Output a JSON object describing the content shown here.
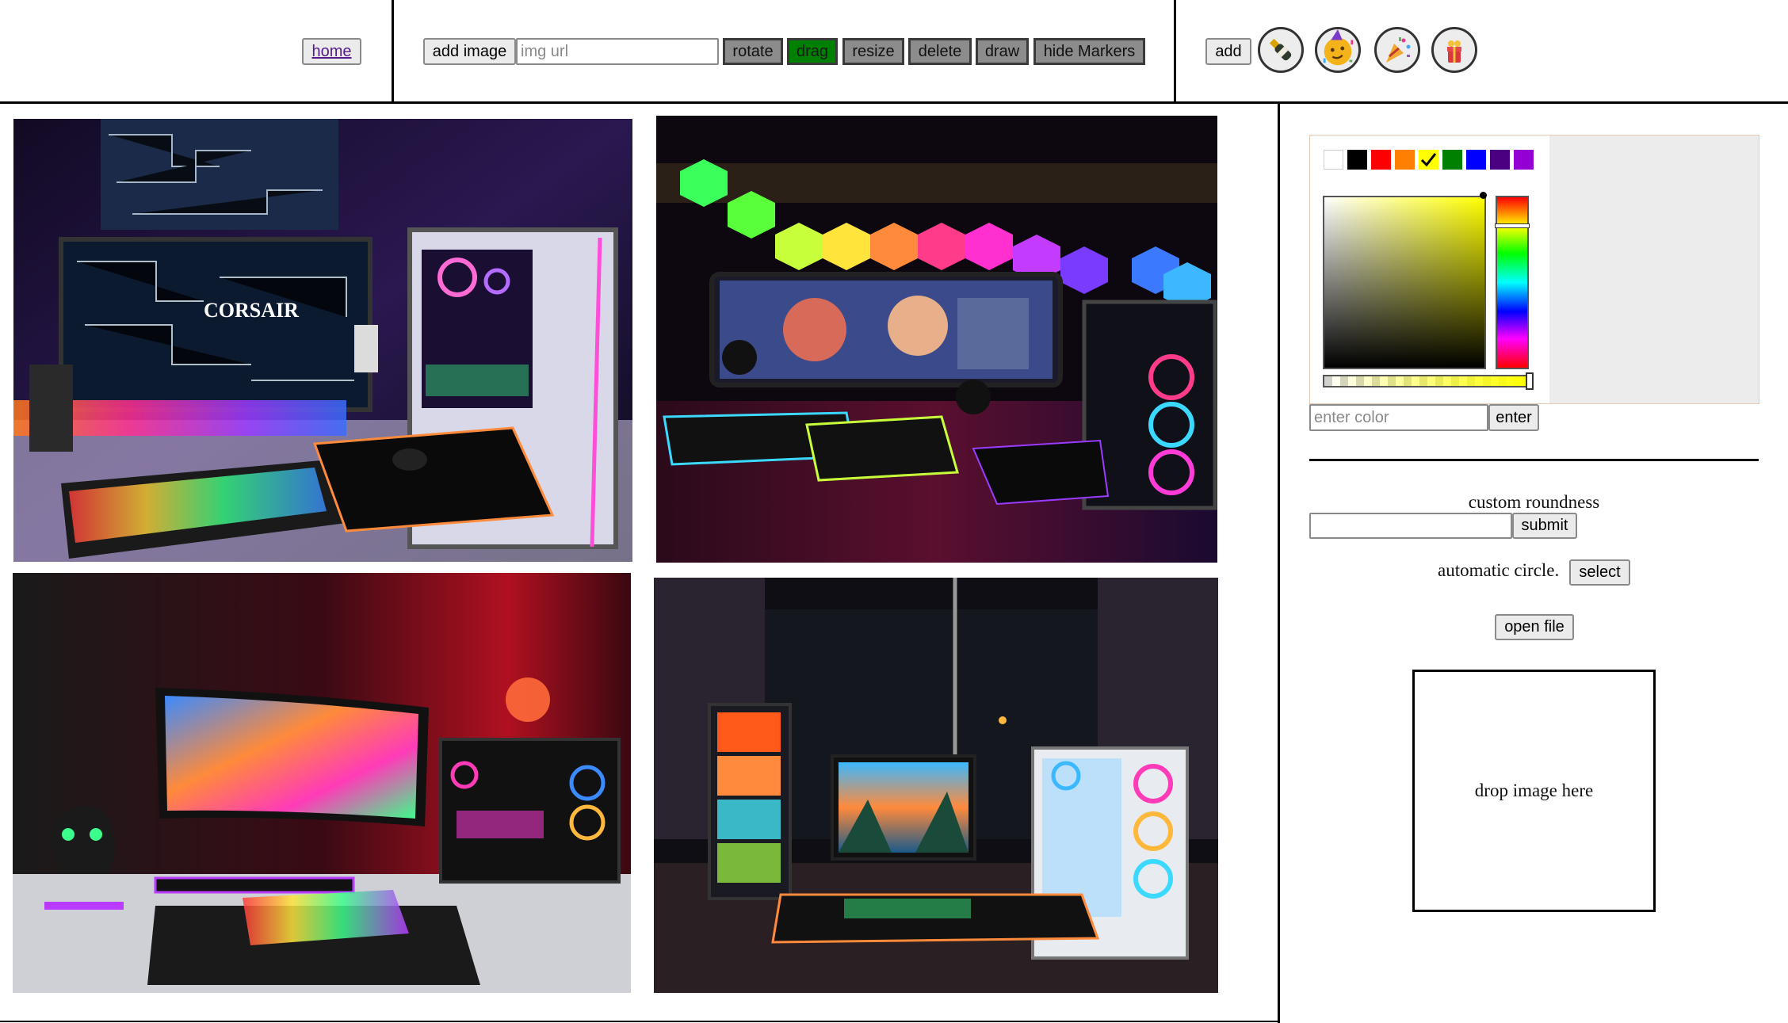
{
  "header": {
    "home_link": "home",
    "add_image_button": "add image",
    "img_url_placeholder": "img url",
    "tools": [
      "rotate",
      "drag",
      "resize",
      "delete",
      "draw",
      "hide Markers"
    ],
    "active_tool": "drag",
    "add_button": "add",
    "emoji_buttons": [
      "champagne-bottle-emoji",
      "partying-face-emoji",
      "party-popper-emoji",
      "gift-emoji"
    ]
  },
  "gallery": {
    "photos": [
      {
        "name": "corsair-rgb-desk-setup",
        "watermark": "CORSAIR"
      },
      {
        "name": "hexagon-light-panel-setup"
      },
      {
        "name": "red-room-gaming-setup"
      },
      {
        "name": "window-night-gaming-setup"
      }
    ]
  },
  "sidebar": {
    "swatches": [
      "#ffffff",
      "#000000",
      "#ff0000",
      "#ff8000",
      "#ffff00",
      "#008000",
      "#0000ff",
      "#4b0082",
      "#9400d3"
    ],
    "selected_swatch": "#ffff00",
    "color_input_placeholder": "enter color",
    "enter_button": "enter",
    "custom_roundness_label": "custom roundness",
    "submit_button": "submit",
    "automatic_circle_label": "automatic circle.",
    "select_button": "select",
    "open_file_button": "open file",
    "drop_zone_text": "drop image here"
  }
}
